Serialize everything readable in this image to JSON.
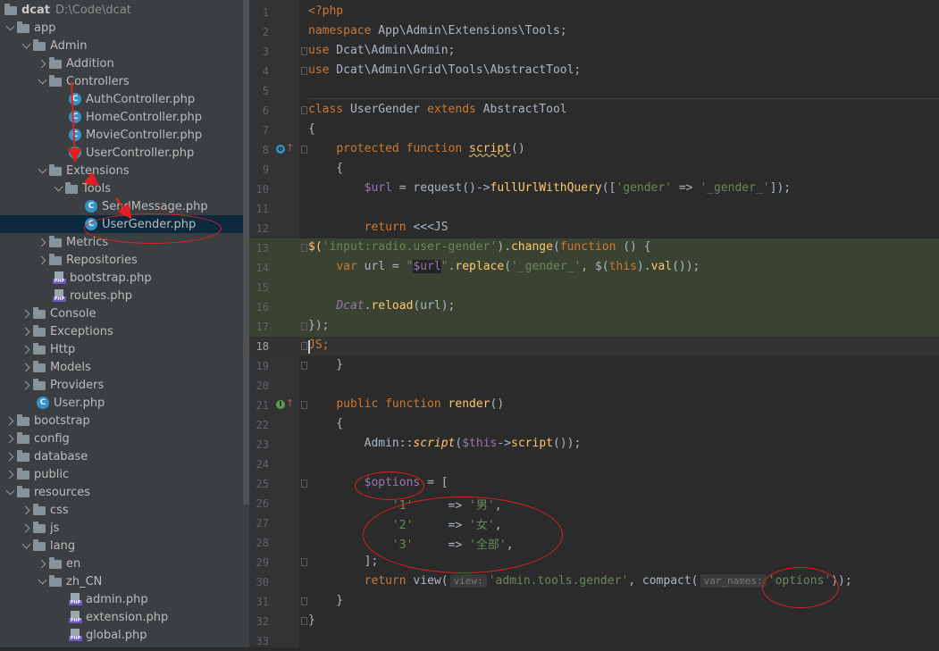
{
  "project": {
    "name": "dcat",
    "path": "D:\\Code\\dcat"
  },
  "tree": [
    {
      "label": "app"
    },
    {
      "label": "Admin"
    },
    {
      "label": "Addition"
    },
    {
      "label": "Controllers"
    },
    {
      "label": "AuthController.php"
    },
    {
      "label": "HomeController.php"
    },
    {
      "label": "MovieController.php"
    },
    {
      "label": "UserController.php"
    },
    {
      "label": "Extensions"
    },
    {
      "label": "Tools"
    },
    {
      "label": "SendMessage.php"
    },
    {
      "label": "UserGender.php"
    },
    {
      "label": "Metrics"
    },
    {
      "label": "Repositories"
    },
    {
      "label": "bootstrap.php"
    },
    {
      "label": "routes.php"
    },
    {
      "label": "Console"
    },
    {
      "label": "Exceptions"
    },
    {
      "label": "Http"
    },
    {
      "label": "Models"
    },
    {
      "label": "Providers"
    },
    {
      "label": "User.php"
    },
    {
      "label": "bootstrap"
    },
    {
      "label": "config"
    },
    {
      "label": "database"
    },
    {
      "label": "public"
    },
    {
      "label": "resources"
    },
    {
      "label": "css"
    },
    {
      "label": "js"
    },
    {
      "label": "lang"
    },
    {
      "label": "en"
    },
    {
      "label": "zh_CN"
    },
    {
      "label": "admin.php"
    },
    {
      "label": "extension.php"
    },
    {
      "label": "global.php"
    }
  ],
  "editor": {
    "current_line": 18,
    "line_numbers": [
      "1",
      "2",
      "3",
      "4",
      "5",
      "6",
      "7",
      "8",
      "9",
      "10",
      "11",
      "12",
      "13",
      "14",
      "15",
      "16",
      "17",
      "18",
      "19",
      "20",
      "21",
      "22",
      "23",
      "24",
      "25",
      "26",
      "27",
      "28",
      "29",
      "30",
      "31",
      "32",
      "33"
    ],
    "code": {
      "l1": "<?php",
      "l2_kw": "namespace",
      "l2_rest": " App\\Admin\\Extensions\\Tools;",
      "l3_kw": "use",
      "l3_rest": " Dcat\\Admin\\Admin;",
      "l4_kw": "use",
      "l4_rest": " Dcat\\Admin\\Grid\\Tools\\AbstractTool;",
      "l6_kw1": "class",
      "l6_name": " UserGender ",
      "l6_kw2": "extends",
      "l6_base": " AbstractTool",
      "l7": "{",
      "l8_indent": "    ",
      "l8_kw": "protected function",
      "l8_fn": "script",
      "l8_rest": "()",
      "l9": "    {",
      "l10_indent": "        ",
      "l10_var": "$url",
      "l10_eq": " = request()->",
      "l10_fn": "fullUrlWithQuery",
      "l10_p1": "([",
      "l10_s1": "'gender'",
      "l10_arrow": " => ",
      "l10_s2": "'_gender_'",
      "l10_end": "]);",
      "l12_indent": "        ",
      "l12_kw": "return",
      "l12_rest": " <<<JS",
      "l13_a": "$(",
      "l13_s": "'input:radio.user-gender'",
      "l13_b": ").",
      "l13_fn": "change",
      "l13_c": "(",
      "l13_kw": "function",
      "l13_d": " () {",
      "l14_indent": "    ",
      "l14_kw": "var",
      "l14_a": " url = ",
      "l14_q1": "\"",
      "l14_var": "$url",
      "l14_q2": "\"",
      "l14_b": ".",
      "l14_fn": "replace",
      "l14_c": "(",
      "l14_s": "'_gender_'",
      "l14_d": ", $(",
      "l14_this": "this",
      "l14_e": ").",
      "l14_fn2": "val",
      "l14_f": "());",
      "l16_indent": "    ",
      "l16_obj": "Dcat",
      "l16_b": ".",
      "l16_fn": "reload",
      "l16_c": "(url);",
      "l17": "});",
      "l18_a": "JS",
      "l18_b": ";",
      "l19": "    }",
      "l21_indent": "    ",
      "l21_kw": "public function",
      "l21_sp": " ",
      "l21_fn": "render",
      "l21_rest": "()",
      "l22": "    {",
      "l23_indent": "        ",
      "l23_a": "Admin::",
      "l23_fn": "script",
      "l23_b": "(",
      "l23_var": "$this",
      "l23_c": "->",
      "l23_fn2": "script",
      "l23_d": "());",
      "l25_indent": "        ",
      "l25_var": "$options",
      "l25_rest": " = [",
      "l26_indent": "            ",
      "l26_k": "'1'",
      "l26_arrow": "     => ",
      "l26_v": "'男'",
      "l26_end": ",",
      "l27_indent": "            ",
      "l27_k": "'2'",
      "l27_arrow": "     => ",
      "l27_v": "'女'",
      "l27_end": ",",
      "l28_indent": "            ",
      "l28_k": "'3'",
      "l28_arrow": "     => ",
      "l28_v": "'全部'",
      "l28_end": ",",
      "l29": "        ];",
      "l30_indent": "        ",
      "l30_kw": "return",
      "l30_a": " view(",
      "l30_hint1": "view:",
      "l30_s1": "'admin.tools.gender'",
      "l30_b": ", compact(",
      "l30_hint2": "var_names:",
      "l30_s2": "'options'",
      "l30_c": "));",
      "l31": "    }",
      "l32": "}"
    }
  },
  "colors": {
    "tree_bg": "#3c3f41",
    "editor_bg": "#2b2b2b",
    "selection": "#0d293e",
    "injected_bg": "#3a4332",
    "annotation": "#e02020"
  }
}
